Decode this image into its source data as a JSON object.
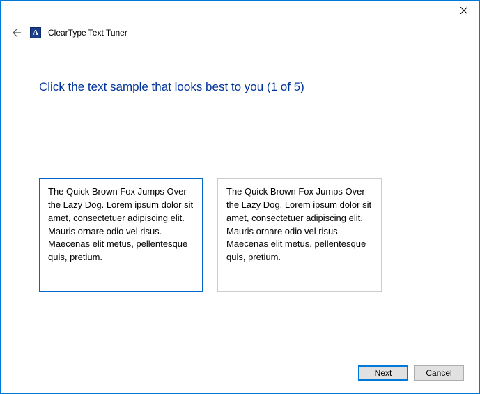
{
  "window": {
    "app_title": "ClearType Text Tuner",
    "app_icon_letter": "A"
  },
  "heading": "Click the text sample that looks best to you (1 of 5)",
  "sample_text": "The Quick Brown Fox Jumps Over the Lazy Dog. Lorem ipsum dolor sit amet, consectetuer adipiscing elit. Mauris ornare odio vel risus. Maecenas elit metus, pellentesque quis, pretium.",
  "buttons": {
    "next": "Next",
    "cancel": "Cancel"
  }
}
